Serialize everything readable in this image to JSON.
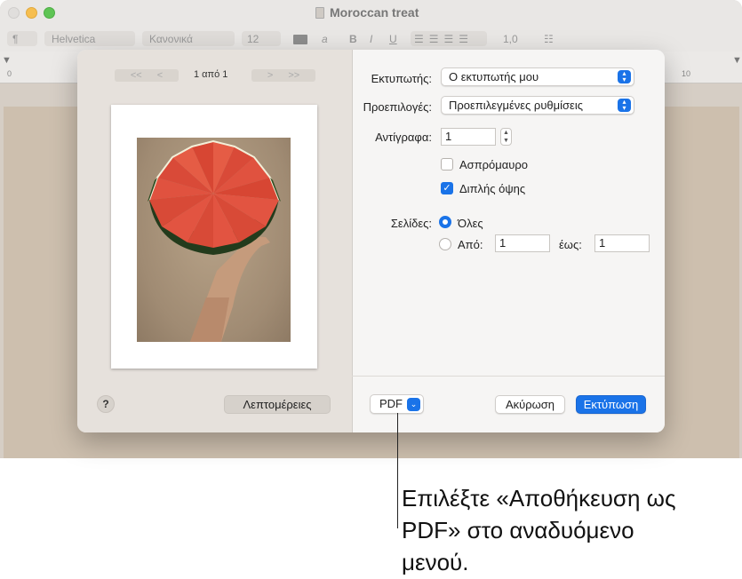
{
  "window": {
    "title": "Moroccan treat"
  },
  "toolbar": {
    "para_style": "¶",
    "font": "Helvetica",
    "typeface": "Κανονικά",
    "size": "12",
    "bold": "B",
    "italic": "I",
    "underline": "U",
    "spacing": "1,0",
    "char_a": "a"
  },
  "ruler": {
    "start": "0",
    "end": "10"
  },
  "preview": {
    "page_count": "1 από 1",
    "first": "<<",
    "prev": "<",
    "next": ">",
    "last": ">>",
    "help": "?",
    "details_button": "Λεπτομέρειες"
  },
  "settings": {
    "printer_label": "Εκτυπωτής:",
    "printer_value": "Ο εκτυπωτής μου",
    "presets_label": "Προεπιλογές:",
    "presets_value": "Προεπιλεγμένες ρυθμίσεις",
    "copies_label": "Αντίγραφα:",
    "copies_value": "1",
    "bw_label": "Ασπρόμαυρο",
    "bw_checked": false,
    "duplex_label": "Διπλής όψης",
    "duplex_checked": true,
    "pages_label": "Σελίδες:",
    "all_label": "Όλες",
    "from_label": "Από:",
    "from_value": "1",
    "to_label": "έως:",
    "to_value": "1"
  },
  "buttons": {
    "pdf": "PDF",
    "cancel": "Ακύρωση",
    "print": "Εκτύπωση"
  },
  "callout": {
    "text": "Επιλέξτε «Αποθήκευση ως PDF» στο αναδυόμενο μενού."
  },
  "colors": {
    "accent": "#1a73e8"
  }
}
